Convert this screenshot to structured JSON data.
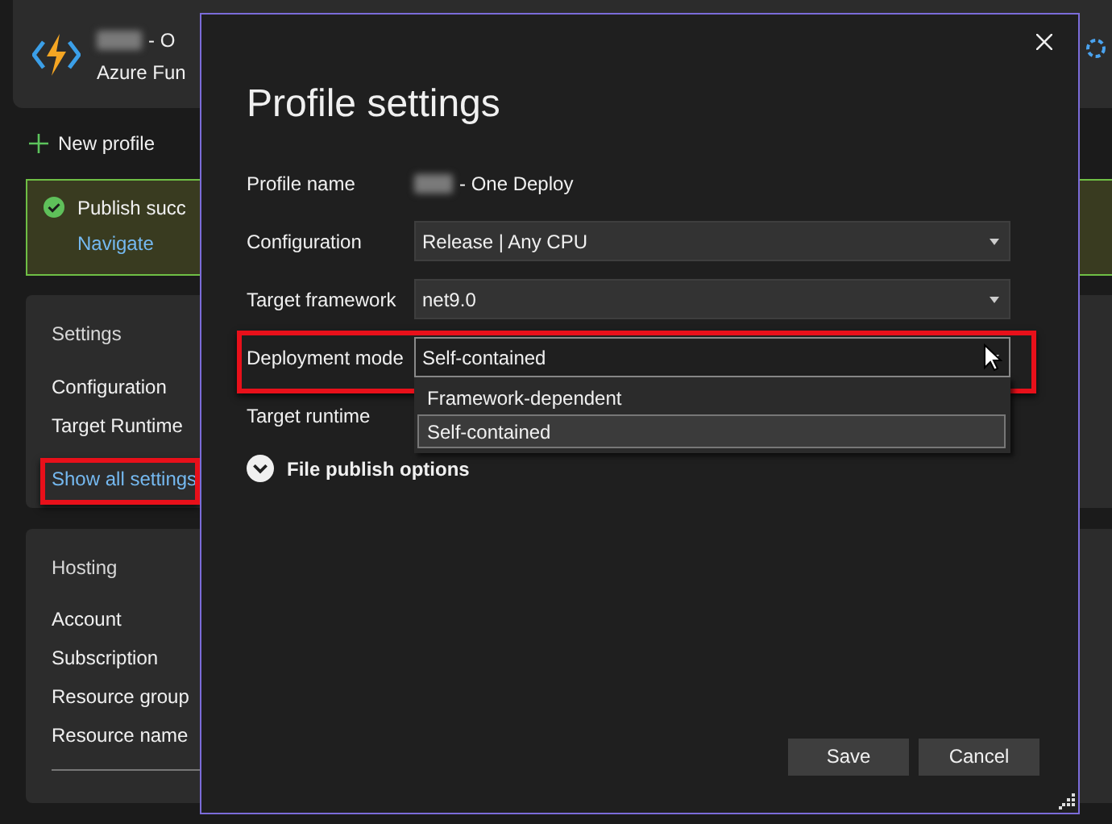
{
  "background": {
    "header": {
      "name_redacted": true,
      "title_suffix": "- O",
      "subtitle": "Azure Fun"
    },
    "new_profile": "New profile",
    "banner": {
      "message": "Publish succ",
      "link": "Navigate"
    },
    "settings": {
      "heading": "Settings",
      "items": [
        "Configuration",
        "Target Runtime"
      ],
      "link": "Show all settings",
      "link_highlighted": true
    },
    "hosting": {
      "heading": "Hosting",
      "items": [
        "Account",
        "Subscription",
        "Resource group",
        "Resource name"
      ]
    }
  },
  "dialog": {
    "title": "Profile settings",
    "fields": [
      {
        "label": "Profile name",
        "kind": "text",
        "value": "- One Deploy",
        "redacted": true,
        "highlighted": false
      },
      {
        "label": "Configuration",
        "kind": "dropdown",
        "value": "Release | Any CPU",
        "expanded": false,
        "highlighted": false
      },
      {
        "label": "Target framework",
        "kind": "dropdown",
        "value": "net9.0",
        "expanded": false,
        "highlighted": false
      },
      {
        "label": "Deployment mode",
        "kind": "dropdown",
        "value": "Self-contained",
        "expanded": true,
        "highlighted": true,
        "options": [
          {
            "label": "Framework-dependent",
            "selected": false
          },
          {
            "label": "Self-contained",
            "selected": true
          }
        ]
      },
      {
        "label": "Target runtime",
        "kind": "covered",
        "highlighted": false
      }
    ],
    "section": {
      "label": "File publish options",
      "expanded": false
    },
    "buttons": [
      "Save",
      "Cancel"
    ]
  }
}
